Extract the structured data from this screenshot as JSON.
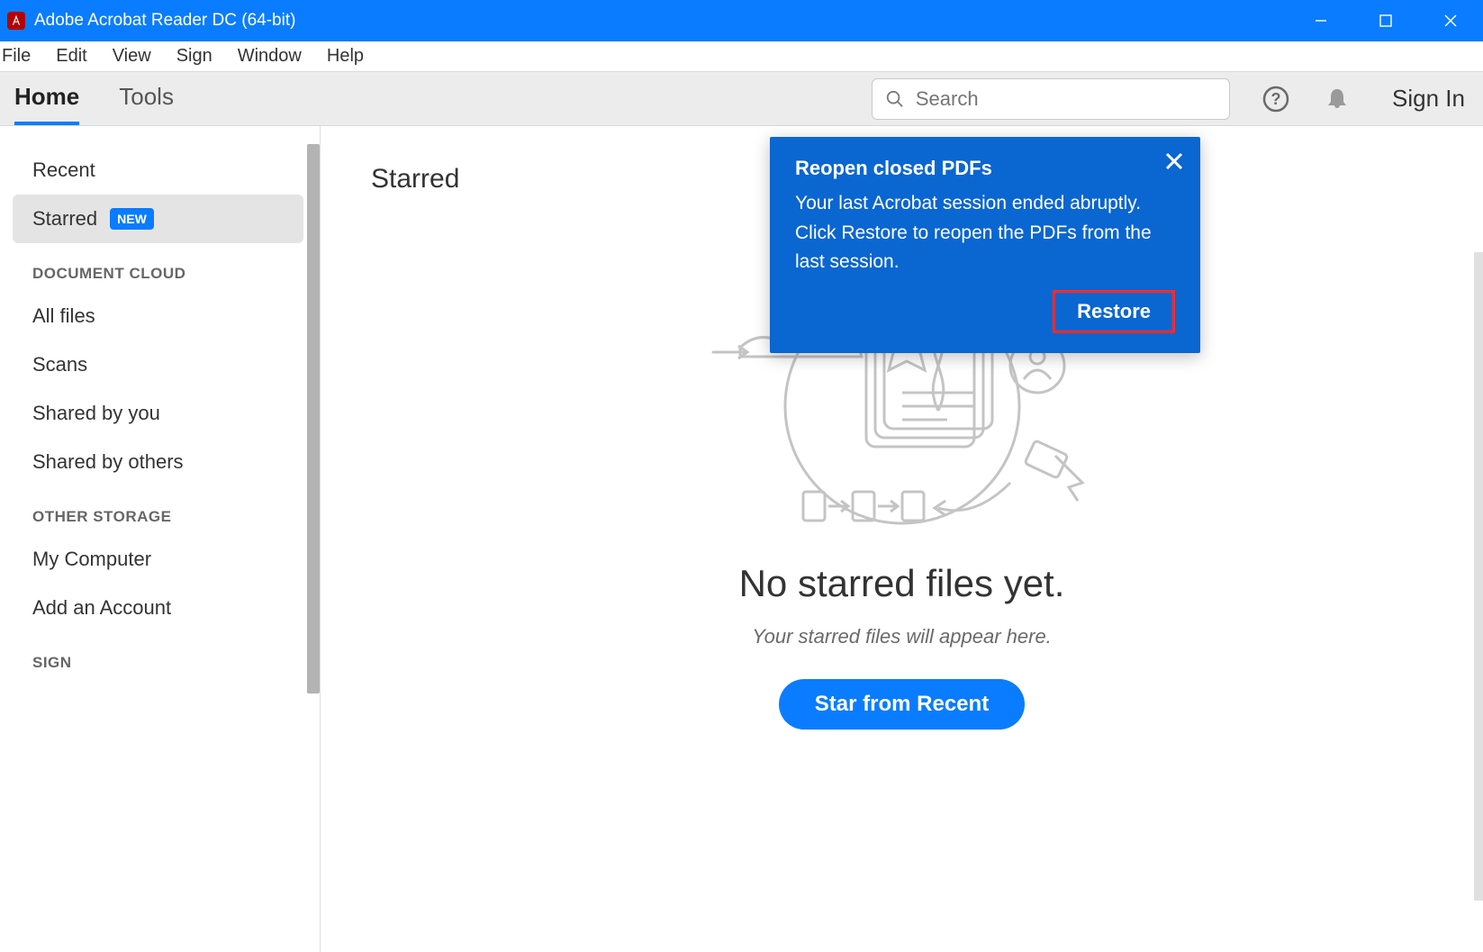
{
  "window": {
    "title": "Adobe Acrobat Reader DC (64-bit)"
  },
  "menubar": {
    "items": [
      "File",
      "Edit",
      "View",
      "Sign",
      "Window",
      "Help"
    ]
  },
  "toolbar": {
    "tabs": [
      {
        "label": "Home",
        "active": true
      },
      {
        "label": "Tools",
        "active": false
      }
    ],
    "search_placeholder": "Search",
    "sign_in": "Sign In"
  },
  "sidebar": {
    "top_items": [
      {
        "label": "Recent",
        "active": false,
        "badge": null
      },
      {
        "label": "Starred",
        "active": true,
        "badge": "NEW"
      }
    ],
    "section1_heading": "DOCUMENT CLOUD",
    "section1_items": [
      "All files",
      "Scans",
      "Shared by you",
      "Shared by others"
    ],
    "section2_heading": "OTHER STORAGE",
    "section2_items": [
      "My Computer",
      "Add an Account"
    ],
    "section3_heading": "SIGN"
  },
  "main": {
    "title": "Starred",
    "empty_heading": "No starred files yet.",
    "empty_subtext": "Your starred files will appear here.",
    "cta_button": "Star from Recent"
  },
  "popup": {
    "title": "Reopen closed PDFs",
    "body": "Your last Acrobat session ended abruptly. Click Restore to reopen the PDFs from the last session.",
    "action": "Restore"
  }
}
